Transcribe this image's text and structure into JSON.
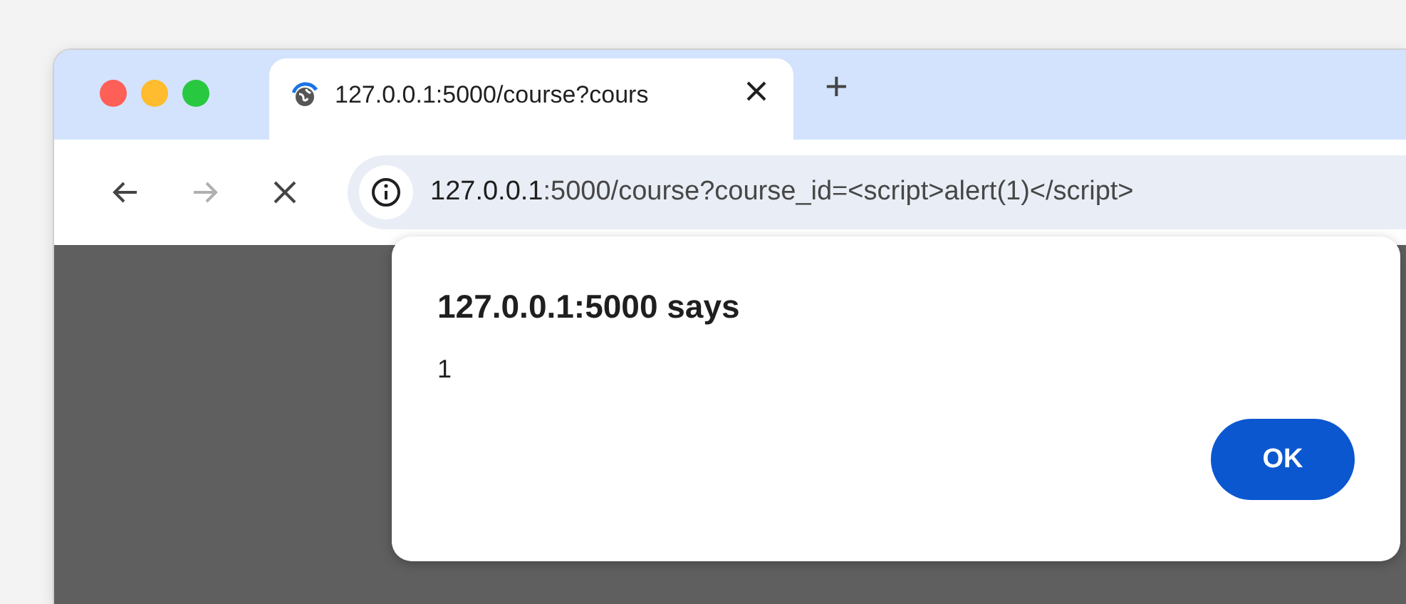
{
  "window": {
    "controls": [
      {
        "color": "#fe5f57"
      },
      {
        "color": "#febc2e"
      },
      {
        "color": "#28c840"
      }
    ]
  },
  "tabs": [
    {
      "title": "127.0.0.1:5000/course?cours",
      "selected": true,
      "loading": true
    }
  ],
  "new_tab": "+",
  "toolbar": {
    "back_disabled": false,
    "forward_disabled": true
  },
  "address_bar": {
    "host": "127.0.0.1",
    "rest": ":5000/course?course_id=<script>alert(1)</script>"
  },
  "dialog": {
    "title": "127.0.0.1:5000 says",
    "message": "1",
    "button": "OK"
  }
}
